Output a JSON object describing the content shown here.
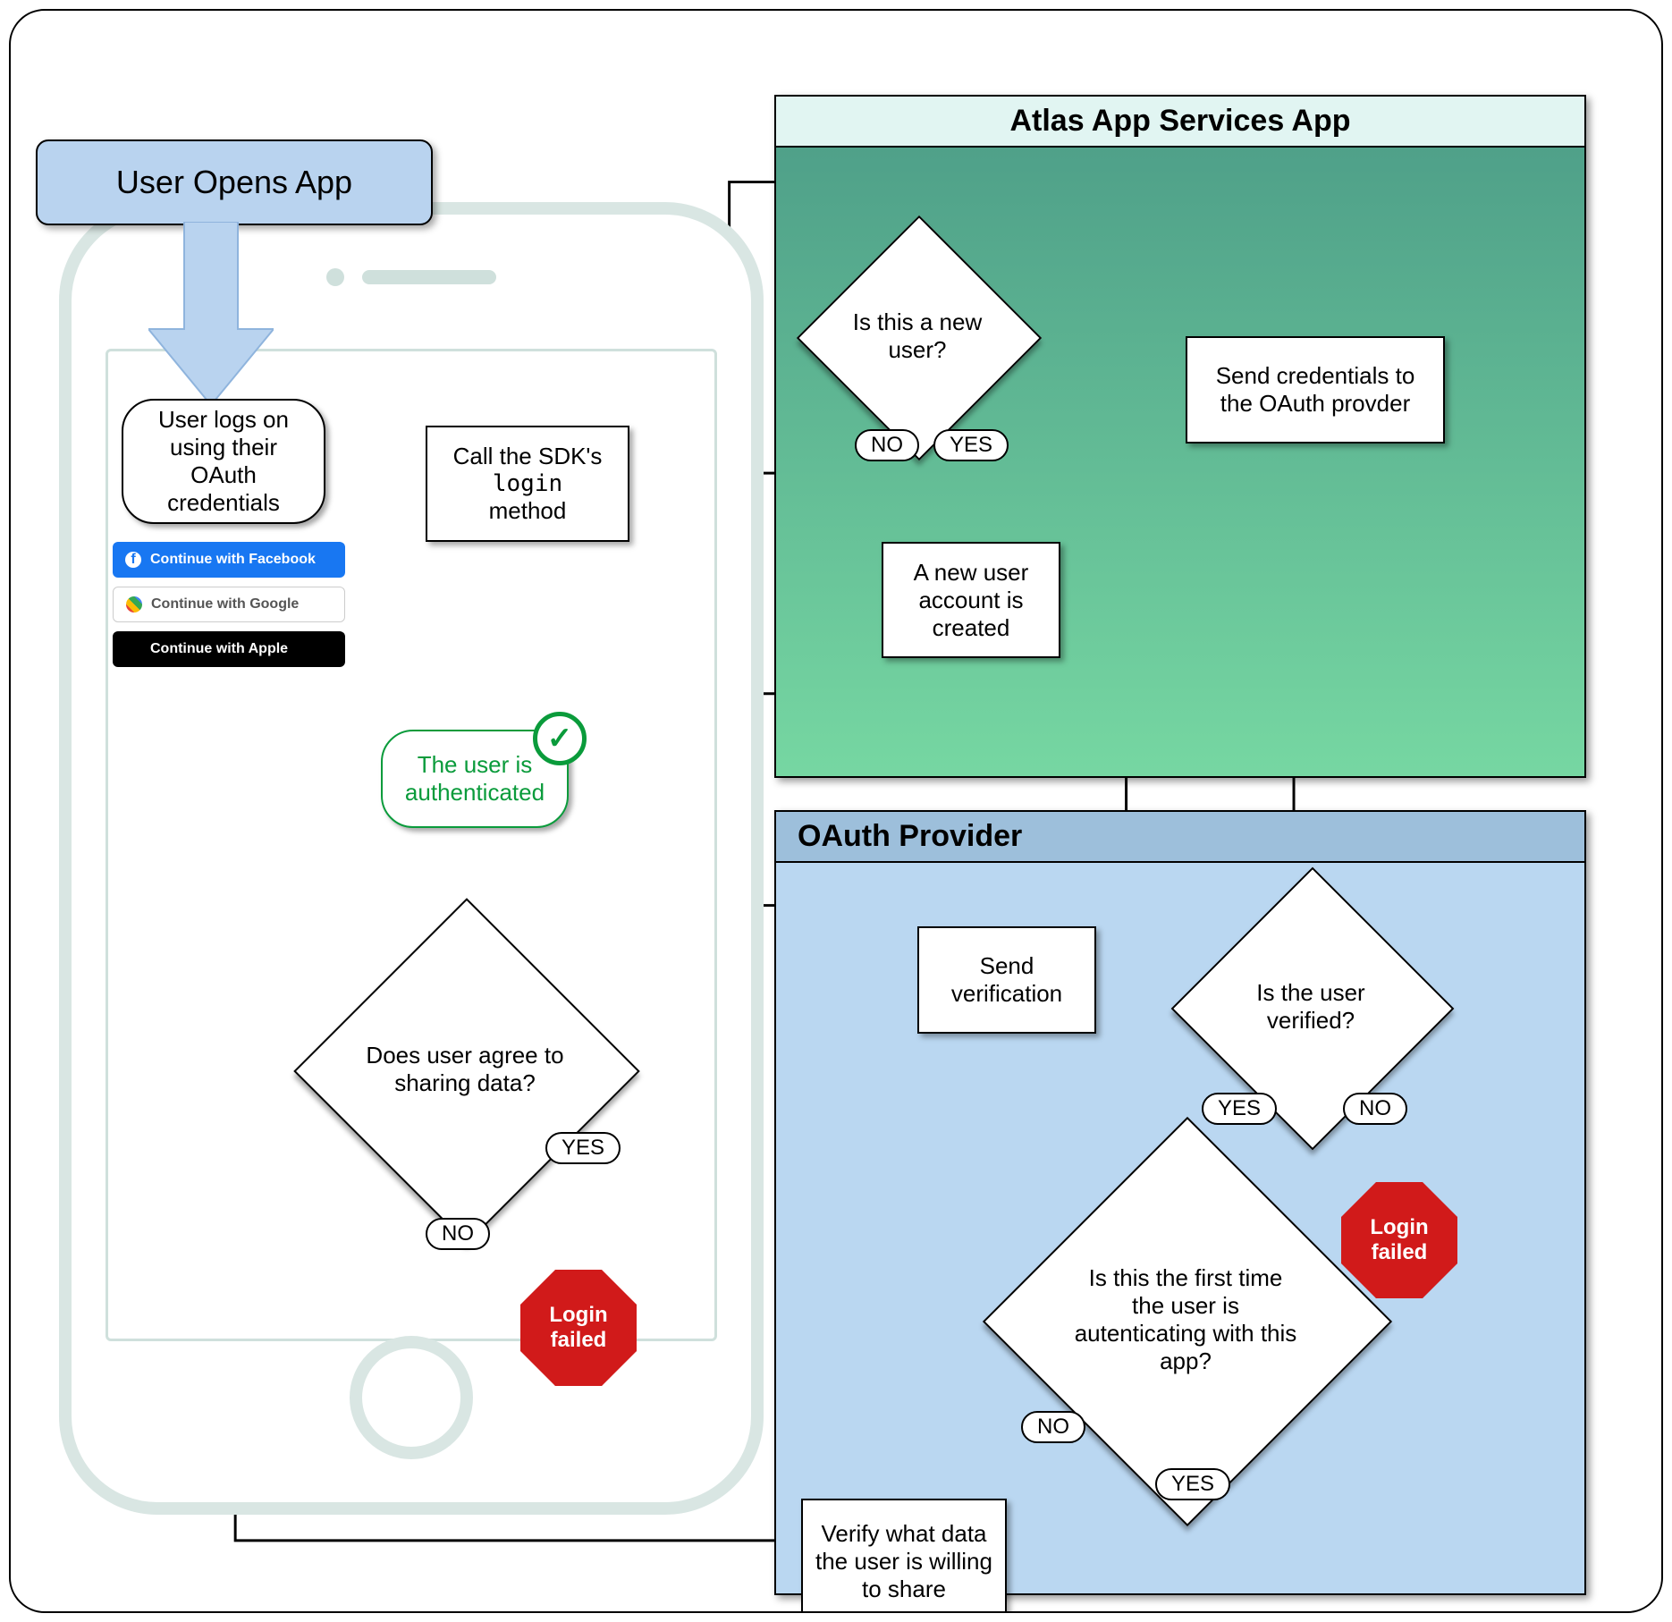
{
  "banner": {
    "label": "User Opens App"
  },
  "regions": {
    "atlas": {
      "title": "Atlas App Services App"
    },
    "oauth": {
      "title": "OAuth Provider"
    }
  },
  "labels": {
    "yes": "YES",
    "no": "NO",
    "login_failed": "Login failed"
  },
  "phone": {
    "user_logs_on": "User logs on using their OAuth credentials",
    "call_sdk": {
      "line1": "Call the SDK's",
      "code": "login",
      "line2": "method"
    },
    "oauth_buttons": {
      "facebook": "Continue with Facebook",
      "google": "Continue with Google",
      "apple": "Continue with Apple"
    },
    "authenticated": "The user is authenticated",
    "share_decision": {
      "question": "Does user agree to sharing data?"
    }
  },
  "atlas": {
    "new_user_q": "Is this a new user?",
    "new_account": "A new user account is created",
    "send_credentials": "Send credentials to the OAuth provder"
  },
  "oauth": {
    "send_verification": "Send verification",
    "verified_q": "Is the user verified?",
    "first_time_q": "Is this the first time the user is autenticating with this app?",
    "verify_share": "Verify what data the user is willing to share"
  }
}
